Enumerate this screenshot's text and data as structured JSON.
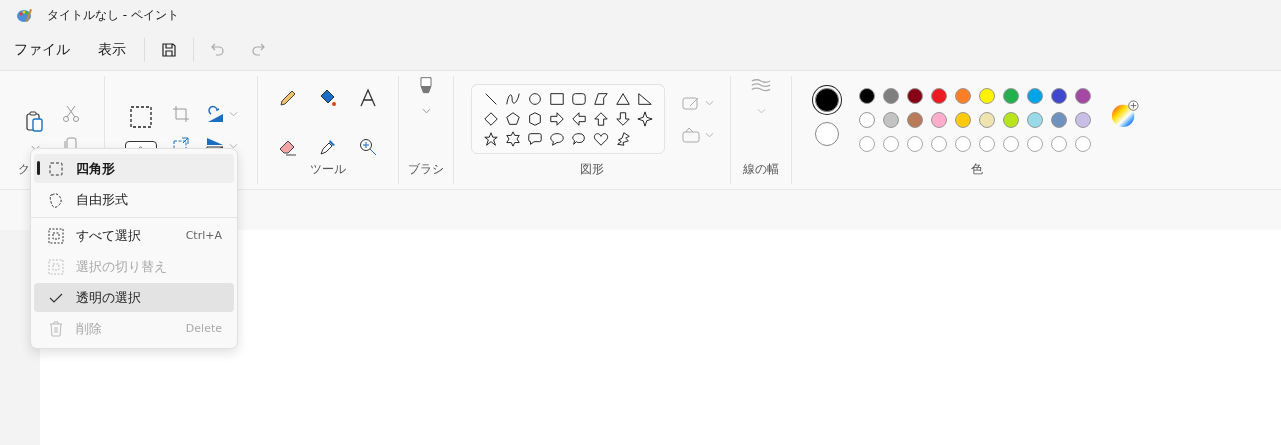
{
  "window": {
    "title": "タイトルなし - ペイント"
  },
  "menu_bar": {
    "items": [
      "ファイル",
      "表示"
    ]
  },
  "ribbon": {
    "clipboard": {
      "label": "ク"
    },
    "tools": {
      "label": "ツール"
    },
    "brushes": {
      "label": "ブラシ"
    },
    "shapes": {
      "label": "図形"
    },
    "size": {
      "label": "線の幅"
    },
    "colors": {
      "label": "色",
      "color_1": {
        "color": "#000000",
        "selected": true
      },
      "color_2": {
        "color": "#ffffff",
        "selected": false
      },
      "palette": [
        {
          "kind": "swatch",
          "color": "#000000"
        },
        {
          "kind": "swatch",
          "color": "#7f7f7f"
        },
        {
          "kind": "swatch",
          "color": "#880015"
        },
        {
          "kind": "swatch",
          "color": "#ed1c24"
        },
        {
          "kind": "swatch",
          "color": "#ff7f27"
        },
        {
          "kind": "swatch",
          "color": "#fff200"
        },
        {
          "kind": "swatch",
          "color": "#22b14c"
        },
        {
          "kind": "swatch",
          "color": "#00a2e8"
        },
        {
          "kind": "swatch",
          "color": "#3f48cc"
        },
        {
          "kind": "swatch",
          "color": "#a349a4"
        },
        {
          "kind": "swatch",
          "color": "#ffffff"
        },
        {
          "kind": "swatch",
          "color": "#c3c3c3"
        },
        {
          "kind": "swatch",
          "color": "#b97a57"
        },
        {
          "kind": "swatch",
          "color": "#ffaec9"
        },
        {
          "kind": "swatch",
          "color": "#ffc90e"
        },
        {
          "kind": "swatch",
          "color": "#efe4b0"
        },
        {
          "kind": "swatch",
          "color": "#b5e61d"
        },
        {
          "kind": "swatch",
          "color": "#99d9ea"
        },
        {
          "kind": "swatch",
          "color": "#7092be"
        },
        {
          "kind": "swatch",
          "color": "#c8bfe7"
        },
        {
          "kind": "empty"
        },
        {
          "kind": "empty"
        },
        {
          "kind": "empty"
        },
        {
          "kind": "empty"
        },
        {
          "kind": "empty"
        },
        {
          "kind": "empty"
        },
        {
          "kind": "empty"
        },
        {
          "kind": "empty"
        },
        {
          "kind": "empty"
        },
        {
          "kind": "empty"
        }
      ]
    }
  },
  "selection_menu": {
    "items": [
      {
        "kind": "item",
        "label": "四角形",
        "selected": true,
        "disabled": false,
        "checked": false,
        "highlighted": false
      },
      {
        "kind": "item",
        "label": "自由形式",
        "selected": false,
        "disabled": false,
        "checked": false,
        "highlighted": false
      },
      {
        "kind": "separator"
      },
      {
        "kind": "item",
        "label": "すべて選択",
        "shortcut": "Ctrl+A",
        "selected": false,
        "disabled": false,
        "checked": false,
        "highlighted": false
      },
      {
        "kind": "item",
        "label": "選択の切り替え",
        "selected": false,
        "disabled": true,
        "checked": false,
        "highlighted": false
      },
      {
        "kind": "item",
        "label": "透明の選択",
        "selected": false,
        "disabled": false,
        "checked": true,
        "highlighted": true
      },
      {
        "kind": "item",
        "label": "削除",
        "shortcut": "Delete",
        "selected": false,
        "disabled": true,
        "checked": false,
        "highlighted": false
      }
    ]
  }
}
